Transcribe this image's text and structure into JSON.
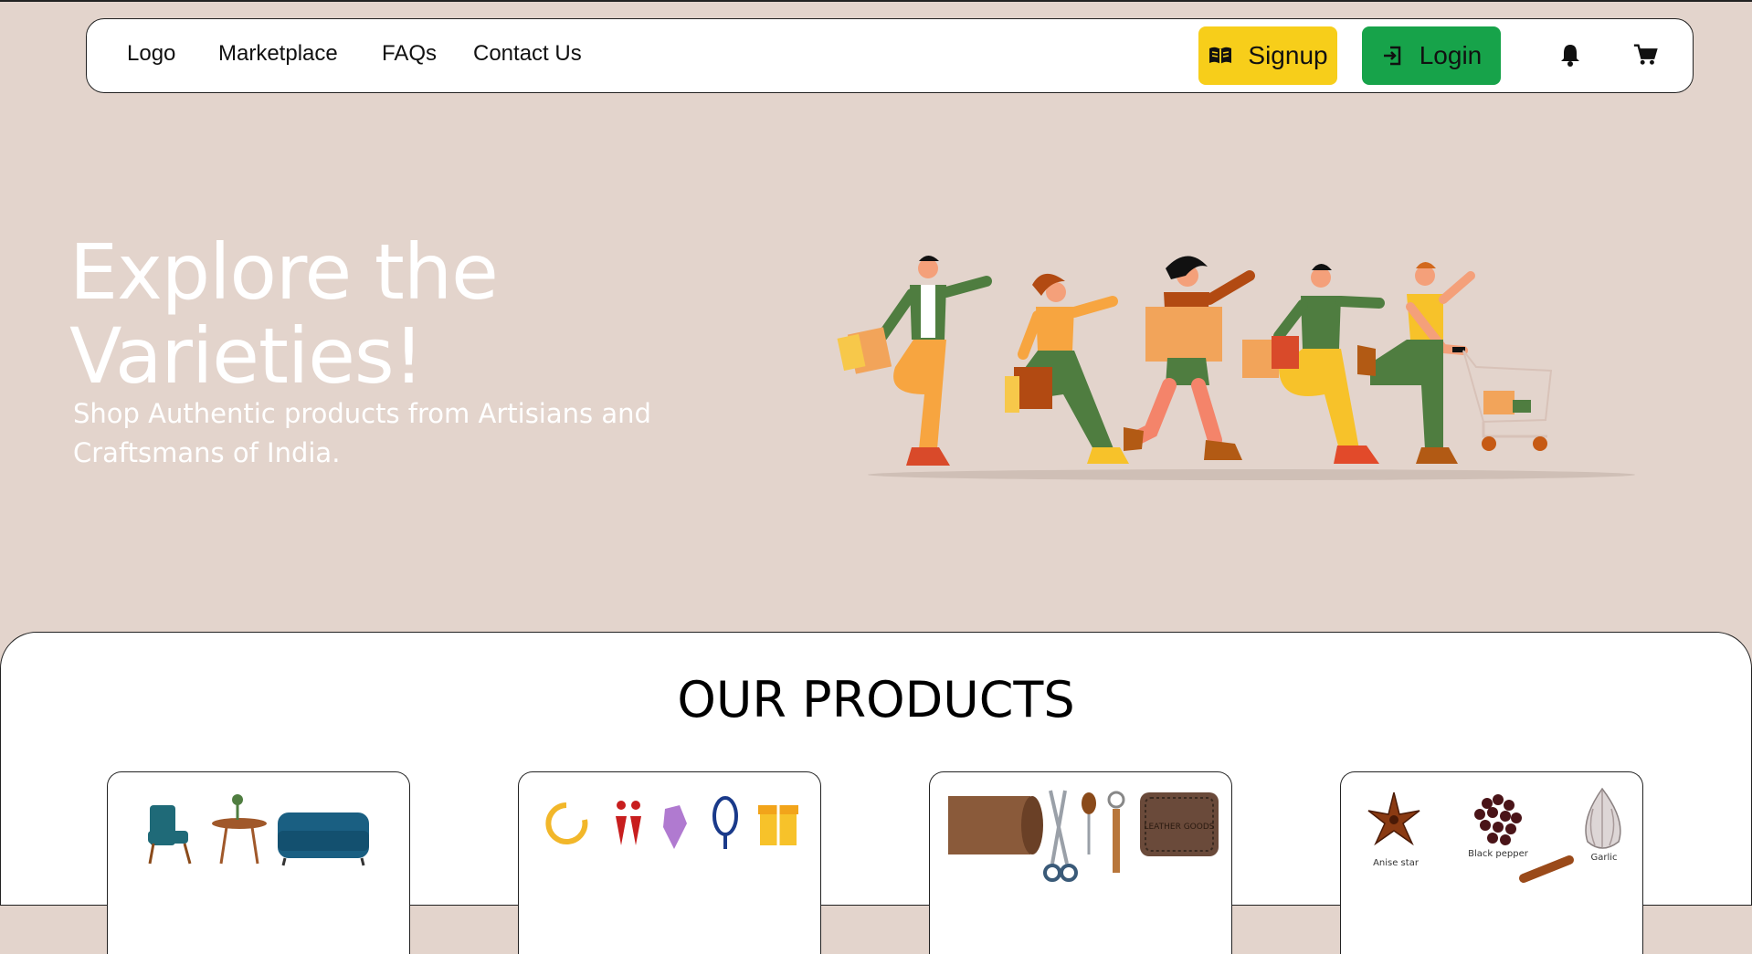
{
  "nav": {
    "links": [
      "Logo",
      "Marketplace",
      "FAQs",
      "Contact Us"
    ],
    "signup_label": "Signup",
    "login_label": "Login",
    "icons": [
      "bell-icon",
      "cart-icon"
    ]
  },
  "hero": {
    "title": "Explore the Varieties!",
    "subtitle": "Shop Authentic products from Artisians and Craftsmans of India."
  },
  "products": {
    "heading": "OUR PRODUCTS",
    "cards": [
      {
        "category_image": "furniture"
      },
      {
        "category_image": "jewellery"
      },
      {
        "category_image": "leather-goods",
        "image_text": "LEATHER GOODS"
      },
      {
        "category_image": "spices",
        "image_labels": [
          "Anise star",
          "Black pepper",
          "Garlic"
        ]
      }
    ]
  },
  "colors": {
    "background": "#e3d4cc",
    "signup": "#f7ce1a",
    "login": "#17a34a"
  }
}
